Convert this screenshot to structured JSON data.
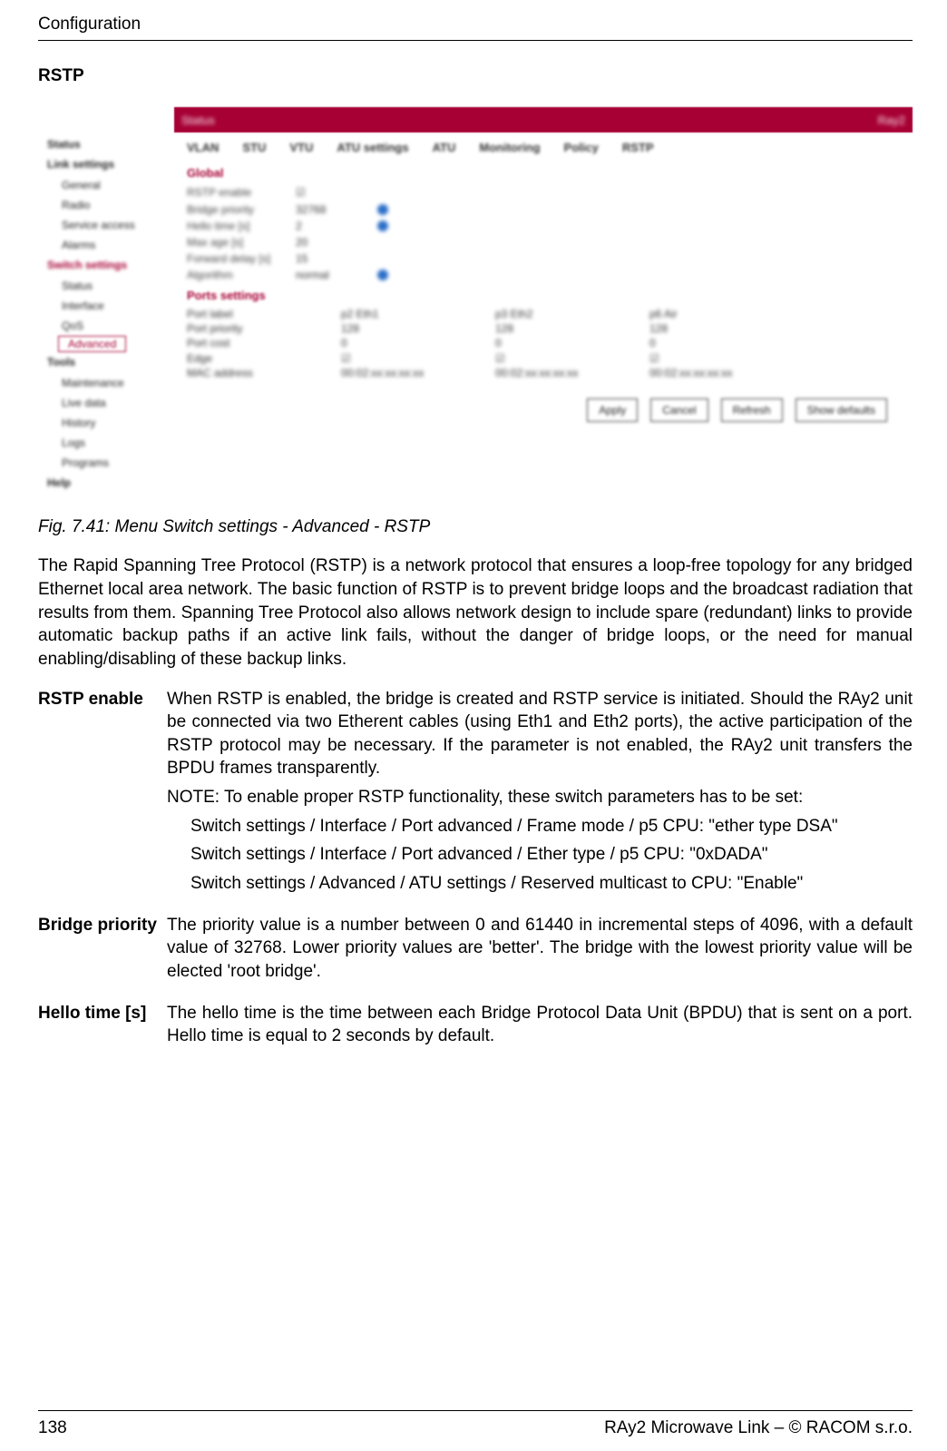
{
  "header": {
    "running_head": "Configuration"
  },
  "title": "RSTP",
  "screenshot": {
    "topbar_left": "Status",
    "topbar_right": "Ray2",
    "left_menu": {
      "items": [
        {
          "label": "Status",
          "cls": "lm-head"
        },
        {
          "label": "Link settings",
          "cls": "lm-head"
        },
        {
          "label": "General",
          "cls": "lm-sub"
        },
        {
          "label": "Radio",
          "cls": "lm-sub"
        },
        {
          "label": "Service access",
          "cls": "lm-sub"
        },
        {
          "label": "Alarms",
          "cls": "lm-sub"
        },
        {
          "label": "Switch settings",
          "cls": "lm-redh"
        },
        {
          "label": "Status",
          "cls": "lm-sub"
        },
        {
          "label": "Interface",
          "cls": "lm-sub"
        },
        {
          "label": "QoS",
          "cls": "lm-sub"
        },
        {
          "label": "Advanced",
          "cls": "lm-active"
        },
        {
          "label": "Tools",
          "cls": "lm-head"
        },
        {
          "label": "Maintenance",
          "cls": "lm-sub"
        },
        {
          "label": "Live data",
          "cls": "lm-sub"
        },
        {
          "label": "History",
          "cls": "lm-sub"
        },
        {
          "label": "Logs",
          "cls": "lm-sub"
        },
        {
          "label": "Programs",
          "cls": "lm-sub"
        },
        {
          "label": "Help",
          "cls": "lm-head"
        }
      ]
    },
    "subtabs": [
      "VLAN",
      "STU",
      "VTU",
      "ATU settings",
      "ATU",
      "Monitoring",
      "Policy",
      "RSTP"
    ],
    "global": {
      "heading": "Global",
      "rows": [
        {
          "lab": "RSTP enable",
          "val": "☑",
          "q": false
        },
        {
          "lab": "Bridge priority",
          "val": "32768",
          "q": true
        },
        {
          "lab": "Hello time [s]",
          "val": "2",
          "q": true
        },
        {
          "lab": "Max age [s]",
          "val": "20",
          "q": false
        },
        {
          "lab": "Forward delay [s]",
          "val": "15",
          "q": false
        },
        {
          "lab": "Algorithm",
          "val": "normal",
          "q": true
        }
      ]
    },
    "ports": {
      "heading": "Ports settings",
      "cols": [
        "Port label",
        "p2 Eth1",
        "p3 Eth2",
        "p6 Air"
      ],
      "rows": [
        [
          "Port priority",
          "128",
          "128",
          "128"
        ],
        [
          "Port cost",
          "0",
          "0",
          "0"
        ],
        [
          "Edge",
          "☑",
          "☑",
          "☑"
        ],
        [
          "MAC address",
          "00:02:xx:xx:xx:xx",
          "00:02:xx:xx:xx:xx",
          "00:02:xx:xx:xx:xx"
        ]
      ]
    },
    "buttons": [
      "Apply",
      "Cancel",
      "Refresh",
      "Show defaults"
    ]
  },
  "caption": "Fig. 7.41: Menu Switch settings - Advanced - RSTP",
  "intro": "The Rapid Spanning Tree Protocol (RSTP) is a network protocol that ensures a loop-free topology for any bridged Ethernet local area network. The basic function of RSTP is to prevent bridge loops and the broadcast radiation that results from them. Spanning Tree Protocol also allows network design to include spare (redundant) links to provide automatic backup paths if an active link fails, without the danger of bridge loops, or the need for manual enabling/disabling of these backup links.",
  "defs": [
    {
      "term": "RSTP enable",
      "paras": [
        "When RSTP is enabled, the bridge is created and RSTP service is initiated. Should the RAy2 unit be connected via two Etherent cables (using Eth1 and Eth2 ports), the active participation of the RSTP protocol may be necessary. If the parameter is not enabled, the RAy2 unit transfers the BPDU frames transparently.",
        "NOTE: To enable proper RSTP functionality, these switch parameters has to be set:"
      ],
      "bullets": [
        "Switch settings / Interface / Port advanced / Frame mode / p5 CPU: \"ether type DSA\"",
        "Switch settings / Interface / Port advanced / Ether type / p5 CPU: \"0xDADA\"",
        "Switch settings / Advanced / ATU settings / Reserved multicast to CPU: \"Enable\""
      ]
    },
    {
      "term": "Bridge priority",
      "paras": [
        "The priority value is a number between 0 and 61440 in incremental steps of 4096, with a default value of 32768. Lower priority values are 'better'. The bridge with the lowest priority value will be elected 'root bridge'."
      ],
      "bullets": []
    },
    {
      "term": "Hello time [s]",
      "paras": [
        "The hello time is the time between each Bridge Protocol Data Unit (BPDU) that is sent on a port. Hello time is equal to 2 seconds by default."
      ],
      "bullets": []
    }
  ],
  "footer": {
    "page_no": "138",
    "right": "RAy2 Microwave Link – © RACOM s.r.o."
  }
}
